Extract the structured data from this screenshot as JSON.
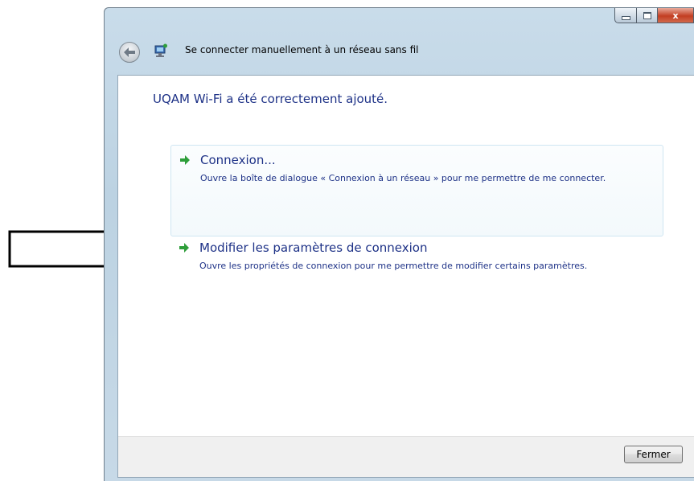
{
  "window": {
    "title": "Se connecter manuellement à un réseau sans fil",
    "caption_close_glyph": "x"
  },
  "content": {
    "heading": "UQAM Wi-Fi a été correctement ajouté.",
    "options": [
      {
        "title": "Connexion...",
        "description": "Ouvre la boîte de dialogue « Connexion à un réseau » pour me permettre de me connecter."
      },
      {
        "title": "Modifier les paramètres de connexion",
        "description": "Ouvre les propriétés de connexion pour me permettre de modifier certains paramètres."
      }
    ]
  },
  "footer": {
    "close_label": "Fermer"
  },
  "colors": {
    "link_text": "#1e3287",
    "arrow_green": "#2e9e3a",
    "close_button_red": "#c23e22"
  },
  "icons": {
    "back": "back-arrow-icon",
    "network": "wireless-network-icon",
    "option_arrow": "green-arrow-icon",
    "annotation": "outline-arrow-icon"
  }
}
